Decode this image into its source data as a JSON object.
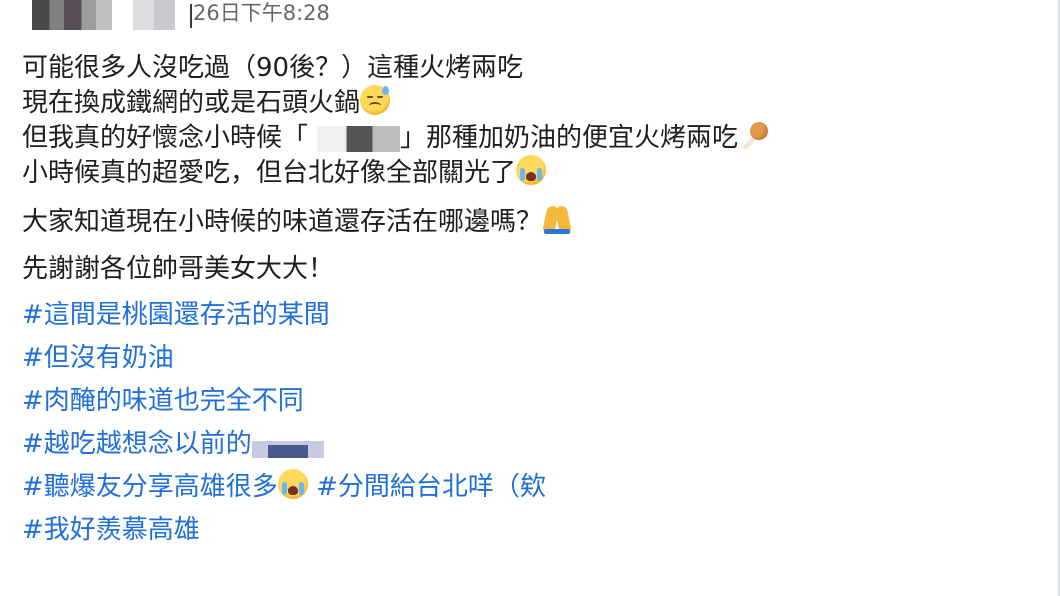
{
  "header": {
    "timestamp": "26日下午8:28"
  },
  "post": {
    "line1": "可能很多人沒吃過（90後？）這種火烤兩吃",
    "line2": "現在換成鐵網的或是石頭火鍋",
    "line3_before": "但我真的好懷念小時候「",
    "line3_after": "」那種加奶油的便宜火烤兩吃",
    "line4": "小時候真的超愛吃，但台北好像全部關光了",
    "line5": "大家知道現在小時候的味道還存活在哪邊嗎？",
    "line6": "先謝謝各位帥哥美女大大！"
  },
  "hashtags": {
    "tag1": "#這間是桃園還存活的某間",
    "tag2": "#但沒有奶油",
    "tag3": "#肉醃的味道也完全不同",
    "tag4": "#越吃越想念以前的",
    "tag5a": "#聽爆友分享高雄很多",
    "tag5b": "#分間給台北咩（欸",
    "tag6": "#我好羨慕高雄"
  },
  "emojis": [
    "downcast-sweat-face",
    "poultry-leg",
    "loudly-crying-face",
    "folded-hands",
    "loudly-crying-face"
  ],
  "colors": {
    "text": "#1c1e21",
    "hashtag": "#216fdb",
    "timestamp": "#65676b"
  }
}
